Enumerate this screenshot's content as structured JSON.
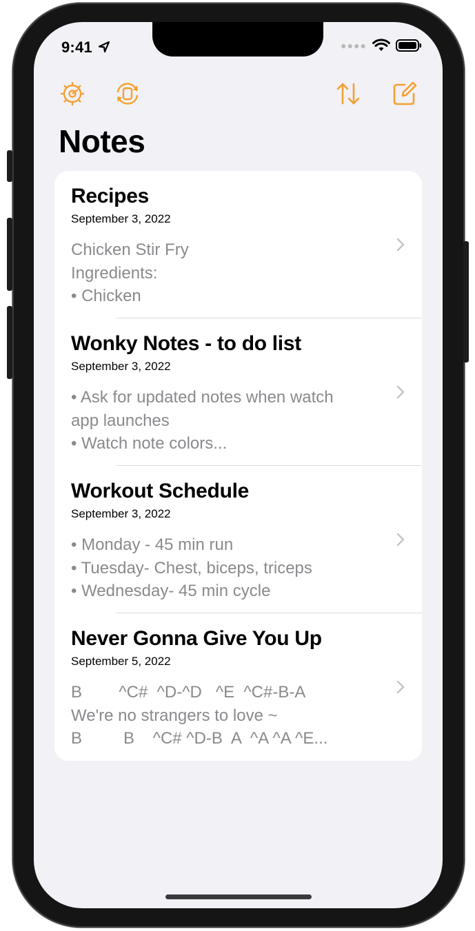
{
  "status": {
    "time": "9:41"
  },
  "header": {
    "title": "Notes"
  },
  "toolbar": {
    "left_icons": [
      "gear-icon",
      "sync-icon"
    ],
    "right_icons": [
      "sort-icon",
      "compose-icon"
    ],
    "accent_color": "#f5a030"
  },
  "notes": [
    {
      "title": "Recipes",
      "date": "September 3, 2022",
      "preview": "Chicken Stir Fry\nIngredients:\n• Chicken"
    },
    {
      "title": "Wonky Notes - to do list",
      "date": "September 3, 2022",
      "preview": "• Ask for updated notes when watch\napp launches\n• Watch note colors..."
    },
    {
      "title": "Workout Schedule",
      "date": "September 3, 2022",
      "preview": "• Monday - 45 min run\n• Tuesday- Chest, biceps, triceps\n• Wednesday- 45 min cycle"
    },
    {
      "title": "Never Gonna Give You Up",
      "date": "September 5, 2022",
      "preview": "B        ^C#  ^D-^D   ^E  ^C#-B-A\nWe're no strangers to love ~\nB         B    ^C# ^D-B  A  ^A ^A ^E..."
    }
  ]
}
